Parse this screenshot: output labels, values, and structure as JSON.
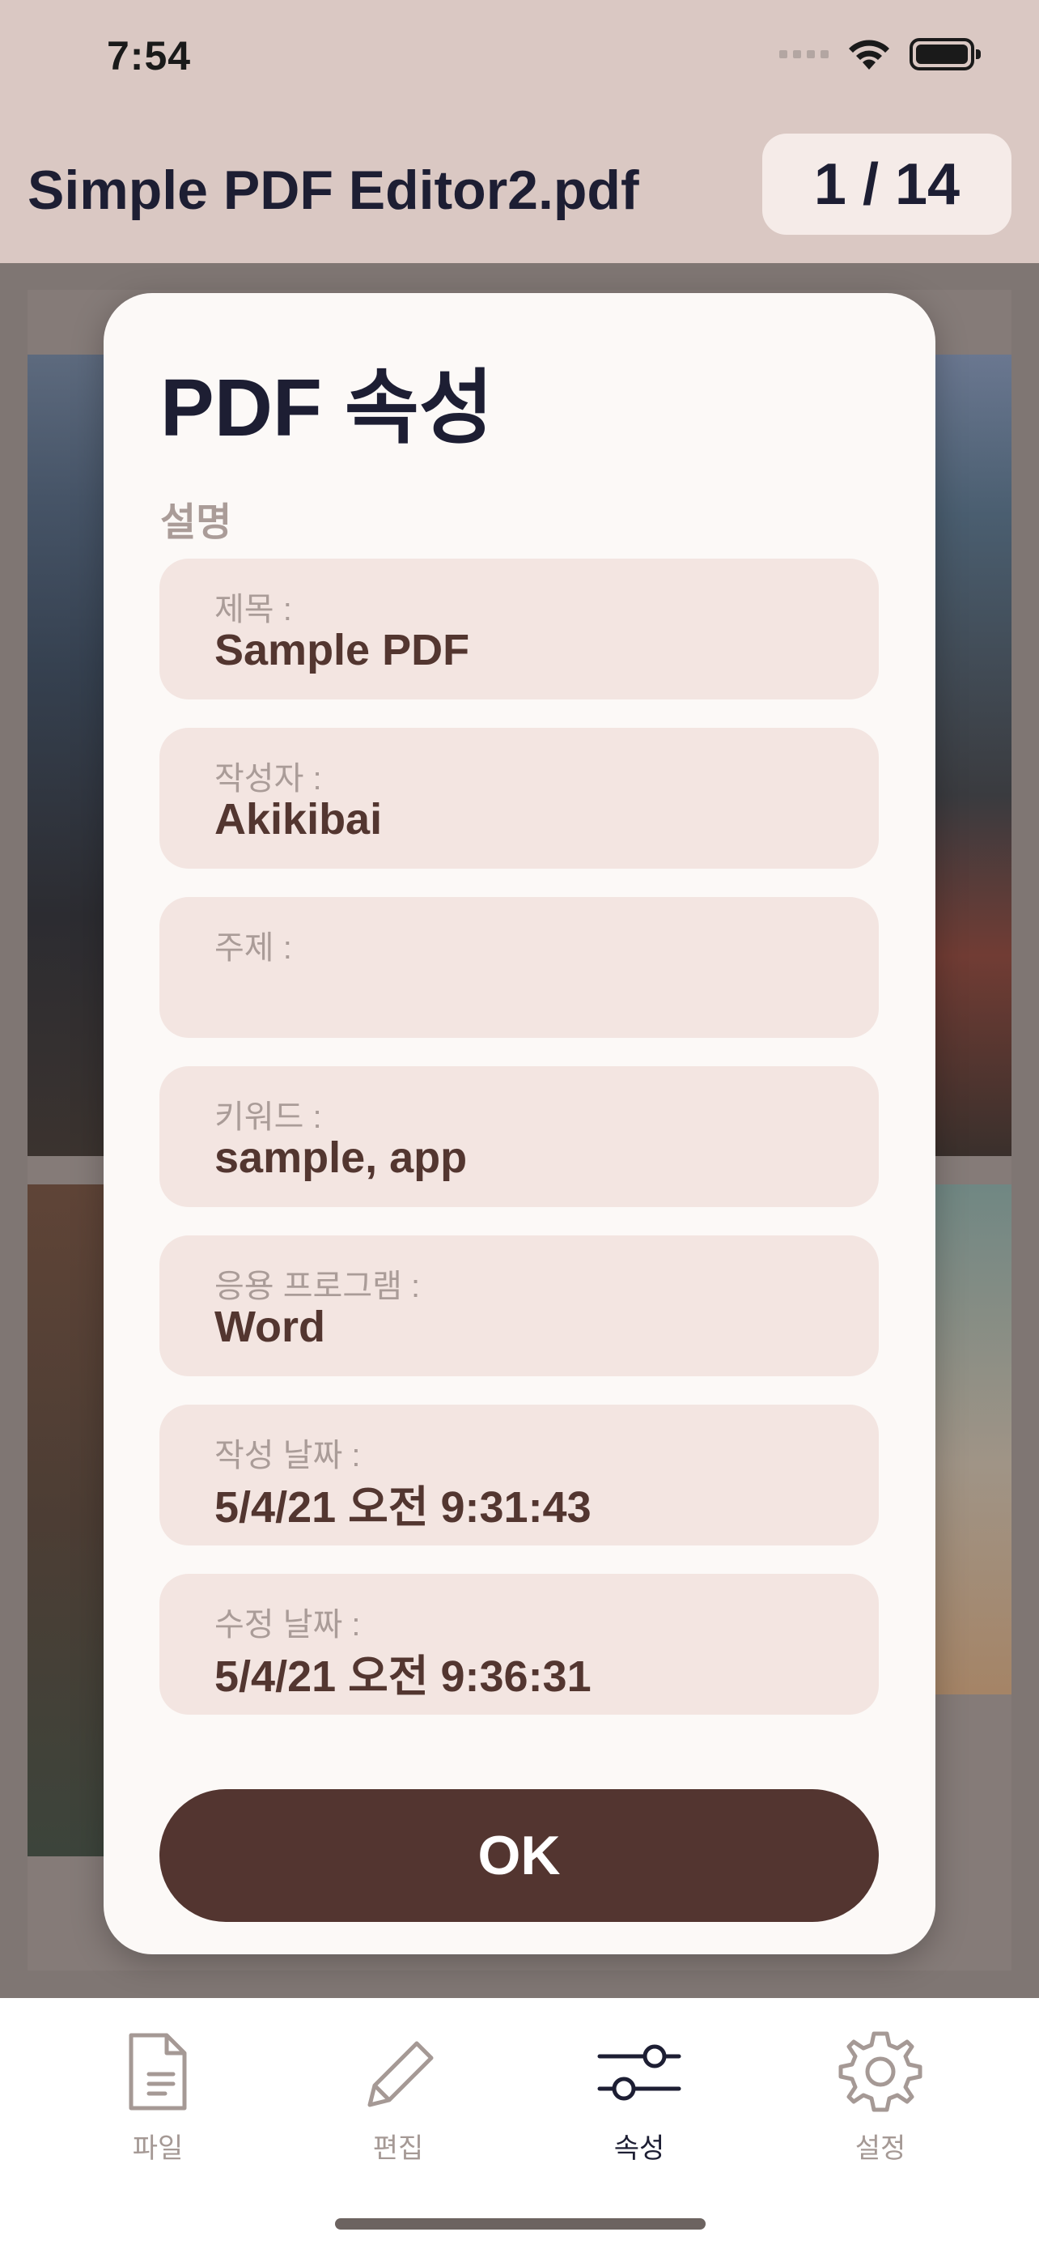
{
  "status_bar": {
    "time": "7:54"
  },
  "header": {
    "title": "Simple PDF Editor2.pdf",
    "page_counter": "1 / 14"
  },
  "dialog": {
    "title": "PDF 속성",
    "section_label": "설명",
    "fields": [
      {
        "label": "제목 :",
        "value": "Sample PDF"
      },
      {
        "label": "작성자 :",
        "value": "Akikibai"
      },
      {
        "label": "주제 :",
        "value": ""
      },
      {
        "label": "키워드 :",
        "value": "sample, app"
      },
      {
        "label": "응용 프로그램 :",
        "value": "Word"
      },
      {
        "label": "작성 날짜 :",
        "value": "5/4/21 오전 9:31:43"
      },
      {
        "label": "수정 날짜 :",
        "value": "5/4/21 오전 9:36:31"
      }
    ],
    "ok_label": "OK"
  },
  "tabbar": {
    "tabs": [
      {
        "label": "파일",
        "icon": "file-icon",
        "active": false
      },
      {
        "label": "편집",
        "icon": "pencil-icon",
        "active": false
      },
      {
        "label": "속성",
        "icon": "sliders-icon",
        "active": true
      },
      {
        "label": "설정",
        "icon": "gear-icon",
        "active": false
      }
    ]
  },
  "colors": {
    "header_bg": "#dac8c3",
    "field_bg": "#f3e5e1",
    "accent": "#533530",
    "title_text": "#1d1e33",
    "muted_text": "#aa9c98"
  }
}
